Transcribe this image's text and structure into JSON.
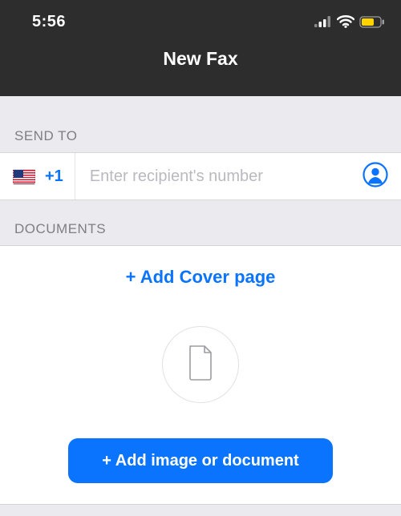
{
  "status": {
    "time": "5:56",
    "signal_icon": "cellular-signal-icon",
    "wifi_icon": "wifi-icon",
    "battery_icon": "battery-low-power-icon"
  },
  "header": {
    "title": "New Fax"
  },
  "send_to": {
    "section_label": "SEND TO",
    "country_code": "+1",
    "country_flag": "us-flag",
    "recipient_placeholder": "Enter recipient's number",
    "recipient_value": "",
    "contact_icon": "contact-circle-icon"
  },
  "documents": {
    "section_label": "DOCUMENTS",
    "add_cover_label": "+ Add Cover page",
    "placeholder_icon": "document-outline-icon",
    "add_button_label": "+ Add image or document"
  },
  "colors": {
    "accent": "#0a74ff",
    "header_bg": "#2d2d2d",
    "page_bg": "#ebebef",
    "battery_fill": "#ffd400"
  }
}
